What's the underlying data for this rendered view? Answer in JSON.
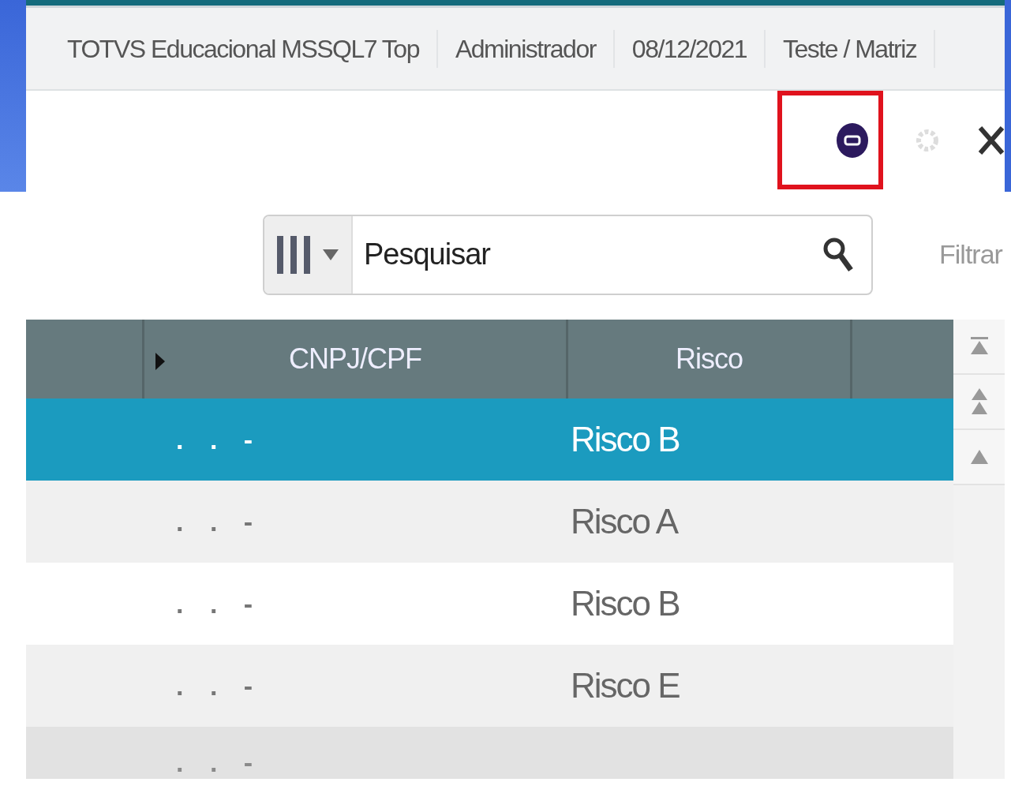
{
  "info_bar": [
    "TOTVS Educacional MSSQL7 Top",
    "Administrador",
    "08/12/2021",
    "Teste / Matriz"
  ],
  "toolbar": {
    "highlighted": true
  },
  "search": {
    "placeholder": "Pesquisar",
    "filter_label": "Filtrar"
  },
  "table": {
    "columns": [
      "CNPJ/CPF",
      "Risco"
    ],
    "rows": [
      {
        "cnpj": ". . -",
        "risco": "Risco B",
        "selected": true
      },
      {
        "cnpj": ". . -",
        "risco": "Risco A",
        "selected": false
      },
      {
        "cnpj": ". . -",
        "risco": "Risco B",
        "selected": false
      },
      {
        "cnpj": ". . -",
        "risco": "Risco E",
        "selected": false
      },
      {
        "cnpj": ". . -",
        "selected": false
      }
    ]
  }
}
